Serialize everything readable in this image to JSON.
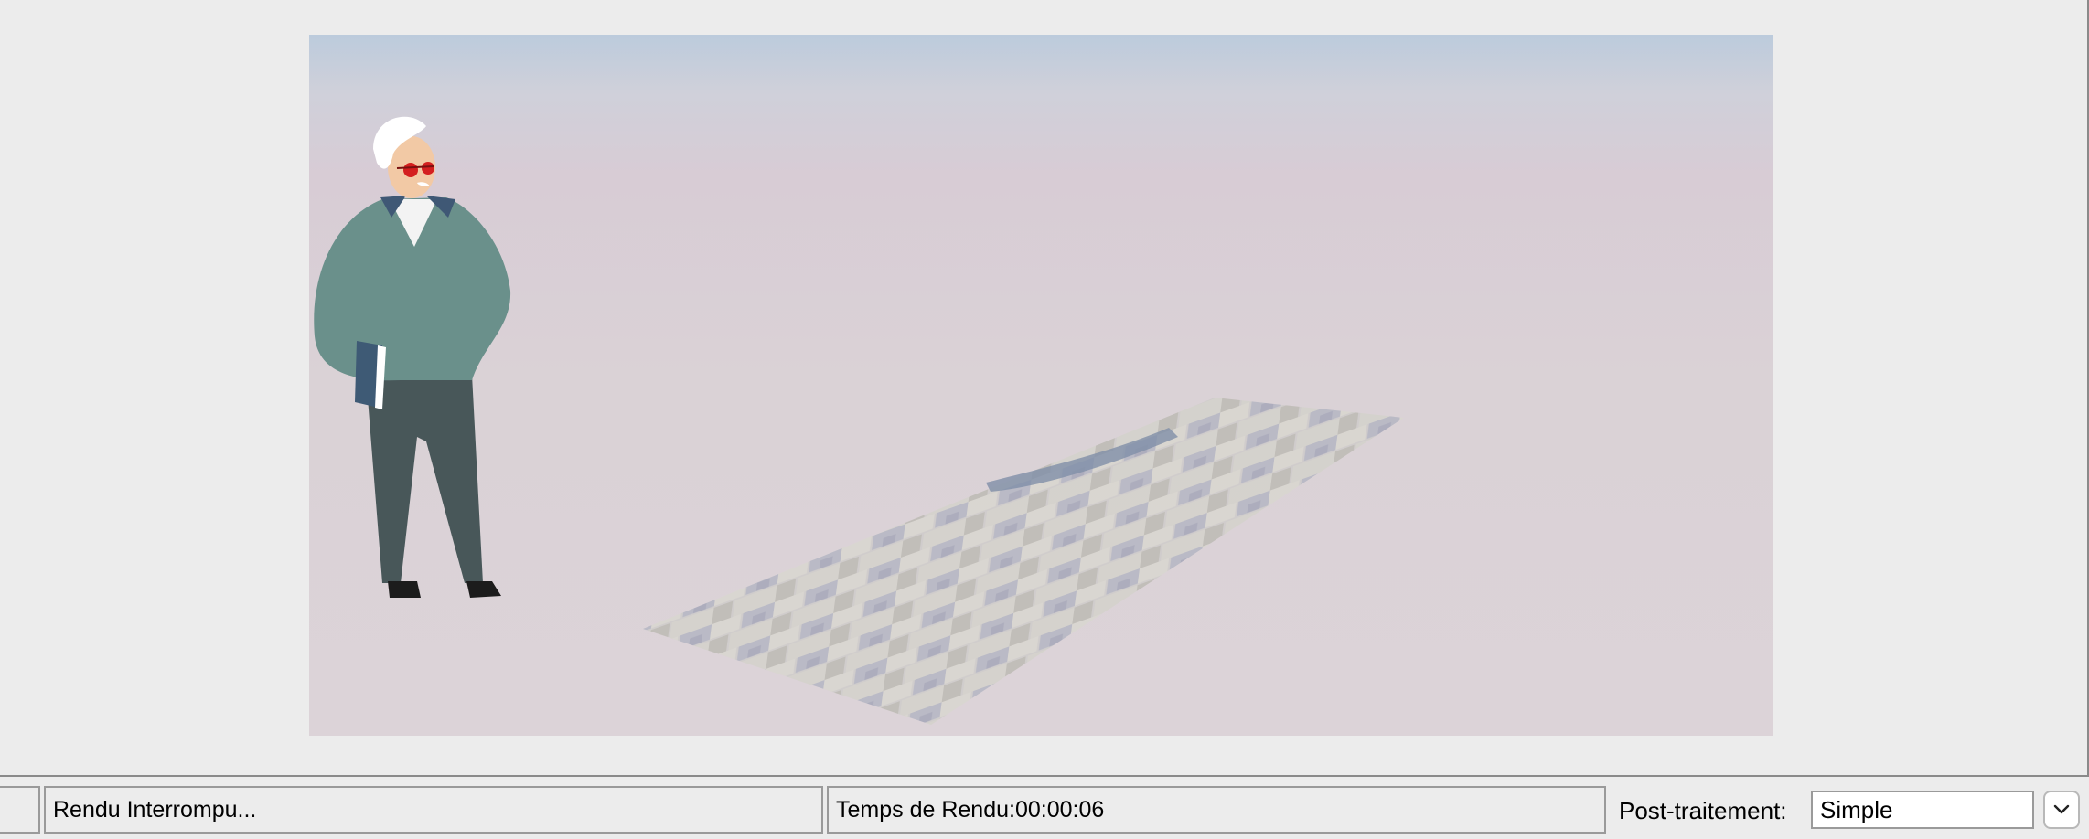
{
  "render": {
    "scene_description_none": ""
  },
  "statusbar": {
    "status_text": "Rendu Interrompu...",
    "render_time": "Temps de Rendu:00:00:06",
    "post_label": "Post-traitement:",
    "post_value": "Simple"
  },
  "colors": {
    "window_bg": "#ececec",
    "border": "#9a9a9a"
  },
  "icons": {
    "dropdown": "chevron-down-icon"
  }
}
